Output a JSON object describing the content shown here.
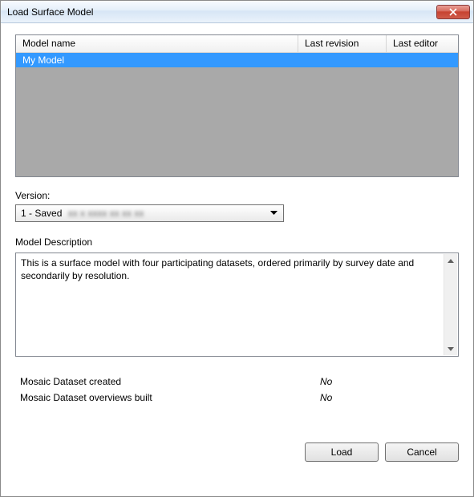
{
  "window": {
    "title": "Load Surface Model"
  },
  "table": {
    "headers": {
      "name": "Model name",
      "revision": "Last revision",
      "editor": "Last editor"
    },
    "rows": [
      {
        "name": "My Model",
        "revision": "",
        "editor": ""
      }
    ]
  },
  "version": {
    "label": "Version:",
    "selected_prefix": "1 - Saved",
    "selected_obscured": "xx x xxxx xx xx xx"
  },
  "description": {
    "label": "Model Description",
    "text": "This is a surface model with four participating datasets, ordered primarily by survey date and secondarily by resolution."
  },
  "status": {
    "mosaic_created_label": "Mosaic Dataset created",
    "mosaic_created_value": "No",
    "overviews_label": "Mosaic Dataset overviews built",
    "overviews_value": "No"
  },
  "buttons": {
    "load": "Load",
    "cancel": "Cancel"
  }
}
